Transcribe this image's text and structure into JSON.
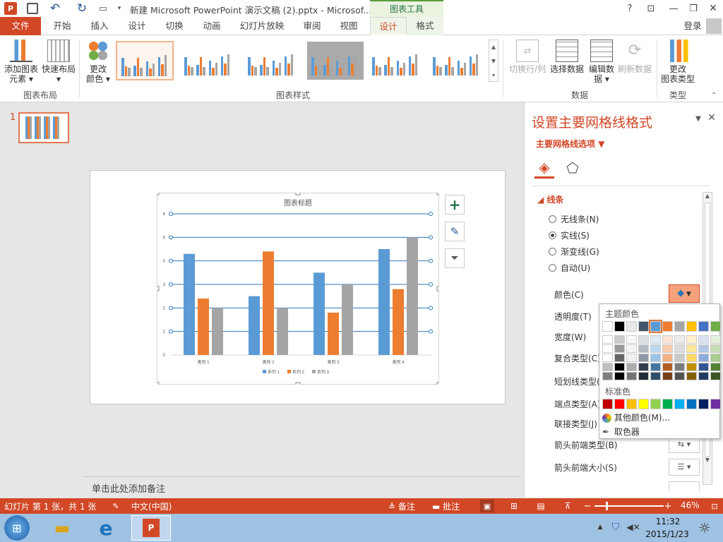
{
  "titlebar": {
    "title": "新建 Microsoft PowerPoint 演示文稿 (2).pptx - Microsof...",
    "context_tool": "图表工具",
    "help": "?"
  },
  "tabs": {
    "file": "文件",
    "items": [
      "开始",
      "插入",
      "设计",
      "切换",
      "动画",
      "幻灯片放映",
      "审阅",
      "视图"
    ],
    "ctx_items": [
      "设计",
      "格式"
    ],
    "selected": "设计",
    "login": "登录"
  },
  "ribbon": {
    "add_element": "添加图表\n元素 ▾",
    "quick_layout": "快速布局\n▾",
    "change_color": "更改\n颜色 ▾",
    "group_layout": "图表布局",
    "group_styles": "图表样式",
    "group_data": "数据",
    "group_type": "类型",
    "switch_rowcol": "切换行/列",
    "select_data": "选择数据",
    "edit_data": "编辑数\n据 ▾",
    "refresh_data": "刷新数据",
    "change_type": "更改\n图表类型"
  },
  "slide": {
    "number": "1",
    "notes_placeholder": "单击此处添加备注"
  },
  "chart_data": {
    "type": "bar",
    "title": "图表标题",
    "categories": [
      "类别 1",
      "类别 2",
      "类别 3",
      "类别 4"
    ],
    "series": [
      {
        "name": "系列 1",
        "values": [
          4.3,
          2.5,
          3.5,
          4.5
        ],
        "color": "#5b9bd5"
      },
      {
        "name": "系列 2",
        "values": [
          2.4,
          4.4,
          1.8,
          2.8
        ],
        "color": "#ed7d31"
      },
      {
        "name": "系列 3",
        "values": [
          2,
          2,
          3,
          5
        ],
        "color": "#a5a5a5"
      }
    ],
    "ylim": [
      0,
      6
    ],
    "yticks": [
      "0",
      "1",
      "2",
      "3",
      "4",
      "5",
      "6"
    ],
    "gridline_color": "#2e75b6",
    "legend": "bottom"
  },
  "format_pane": {
    "title": "设置主要网格线格式",
    "options_label": "主要网格线选项 ▼",
    "section": "线条",
    "radios": [
      {
        "label": "无线条(N)",
        "checked": false
      },
      {
        "label": "实线(S)",
        "checked": true
      },
      {
        "label": "渐变线(G)",
        "checked": false
      },
      {
        "label": "自动(U)",
        "checked": false
      }
    ],
    "props": [
      "颜色(C)",
      "透明度(T)",
      "宽度(W)",
      "复合类型(C)",
      "短划线类型(D)",
      "端点类型(A)",
      "联接类型(J)",
      "箭头前端类型(B)",
      "箭头前端大小(S)"
    ]
  },
  "color_picker": {
    "theme_label": "主题颜色",
    "theme_colors": [
      "#ffffff",
      "#000000",
      "#e7e6e6",
      "#44546a",
      "#5b9bd5",
      "#ed7d31",
      "#a5a5a5",
      "#ffc000",
      "#4472c4",
      "#70ad47"
    ],
    "standard_label": "标准色",
    "standard_colors": [
      "#c00000",
      "#ff0000",
      "#ffc000",
      "#ffff00",
      "#92d050",
      "#00b050",
      "#00b0f0",
      "#0070c0",
      "#002060",
      "#7030a0"
    ],
    "more_colors": "其他颜色(M)...",
    "eyedropper": "取色器"
  },
  "status": {
    "slide_info": "幻灯片 第 1 张，共 1 张",
    "language": "中文(中国)",
    "notes": "备注",
    "comments": "批注",
    "zoom": "46%"
  },
  "taskbar": {
    "time": "11:32",
    "date": "2015/1/23"
  }
}
